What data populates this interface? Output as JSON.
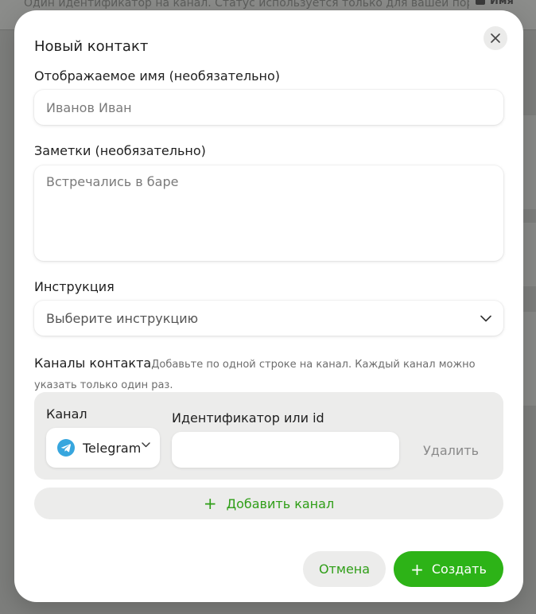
{
  "background": {
    "hint_text": "Один идентификатор на канал. Статус используется только для вашей пор",
    "chip_text": "Имя"
  },
  "modal": {
    "title": "Новый контакт",
    "close_icon": "close-icon",
    "display_name": {
      "label": "Отображаемое имя (необязательно)",
      "placeholder": "Иванов Иван",
      "value": ""
    },
    "notes": {
      "label": "Заметки (необязательно)",
      "placeholder": "Встречались в баре",
      "value": ""
    },
    "instruction": {
      "label": "Инструкция",
      "selected": "Выберите инструкцию",
      "icon": "chevron-down-icon"
    },
    "channels": {
      "heading": "Каналы контакта",
      "hint": "Добавьте по одной строке на канал. Каждый канал можно указать только один раз.",
      "rows": [
        {
          "channel_label": "Канал",
          "channel_value": "Telegram",
          "channel_icon": "telegram-icon",
          "id_label": "Идентификатор или id",
          "id_value": "",
          "delete_label": "Удалить"
        }
      ],
      "add_label": "Добавить канал"
    },
    "footer": {
      "cancel_label": "Отмена",
      "create_label": "Создать"
    }
  },
  "colors": {
    "accent": "#2db317",
    "accent_text": "#2f9e17",
    "telegram": "#37a6de"
  }
}
